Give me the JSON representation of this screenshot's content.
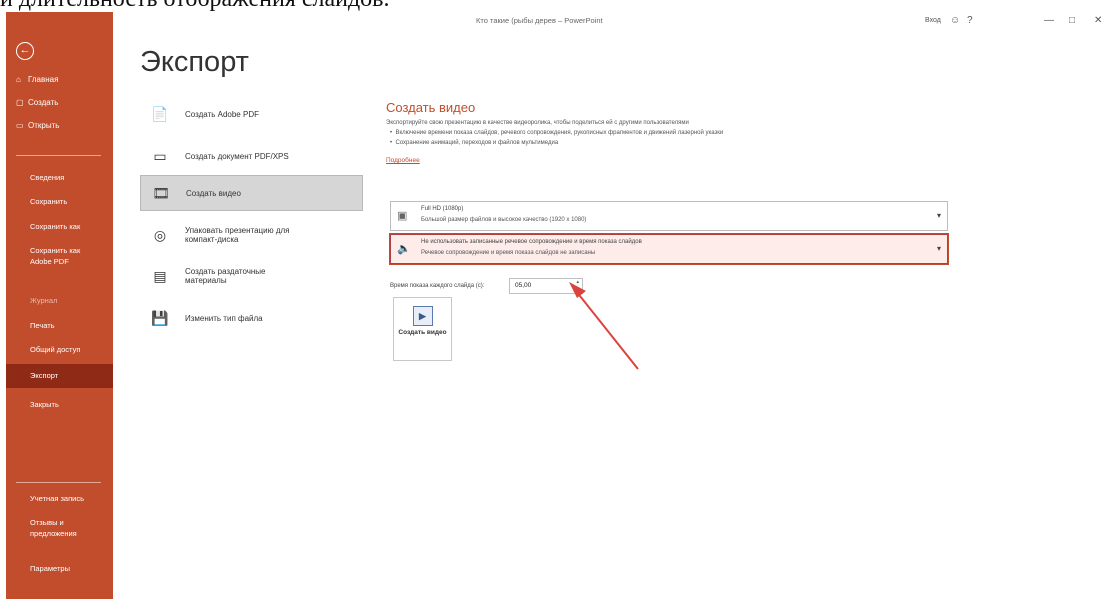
{
  "caption": "и длительность отображения слайдов.",
  "window": {
    "title": "Кто такие (рыбы дерев – PowerPoint",
    "account": "Вход",
    "controls": [
      "?",
      "—",
      "□",
      "✕"
    ]
  },
  "sidebar": {
    "back_icon": "back-arrow-icon",
    "items": [
      {
        "label": "Главная",
        "icon": "home-icon"
      },
      {
        "label": "Создать",
        "icon": "new-doc-icon"
      },
      {
        "label": "Открыть",
        "icon": "folder-open-icon"
      },
      {
        "label": "Сведения"
      },
      {
        "label": "Сохранить"
      },
      {
        "label": "Сохранить как"
      },
      {
        "label": "Сохранить как Adobe PDF"
      },
      {
        "label": "Журнал"
      },
      {
        "label": "Печать"
      },
      {
        "label": "Общий доступ"
      },
      {
        "label": "Экспорт"
      },
      {
        "label": "Закрыть"
      },
      {
        "label": "Учетная запись"
      },
      {
        "label": "Отзывы и предложения"
      },
      {
        "label": "Параметры"
      }
    ]
  },
  "page_title": "Экспорт",
  "options": [
    {
      "label": "Создать Adobe PDF",
      "icon": "adobe-pdf-icon"
    },
    {
      "label": "Создать документ PDF/XPS",
      "icon": "pdf-xps-icon"
    },
    {
      "label": "Создать видео",
      "icon": "video-icon"
    },
    {
      "label": "Упаковать презентацию для компакт-диска",
      "icon": "cd-package-icon"
    },
    {
      "label": "Создать раздаточные материалы",
      "icon": "handouts-icon"
    },
    {
      "label": "Изменить тип файла",
      "icon": "file-type-icon"
    }
  ],
  "detail": {
    "heading": "Создать видео",
    "description": "Экспортируйте свою презентацию в качестве видеоролика, чтобы поделиться ей с другими пользователями",
    "bullets": [
      "Включение времени показа слайдов, речевого сопровождения, рукописных фрагментов и движений лазерной указки",
      "Сохранение анимаций, переходов и файлов мультимедиа"
    ],
    "link": "Подробнее",
    "quality": {
      "title": "Full HD (1080p)",
      "subtitle": "Большой размер файлов и высокое качество (1920 x 1080)"
    },
    "narration": {
      "title": "Не использовать записанные речевое сопровождение и время показа слайдов",
      "subtitle": "Речевое сопровождение и время показа слайдов не записаны"
    },
    "time_label": "Время показа каждого слайда (с):",
    "time_value": "05,00",
    "create_button": "Создать видео"
  },
  "annotation": {
    "arrow_color": "#d9453c"
  }
}
